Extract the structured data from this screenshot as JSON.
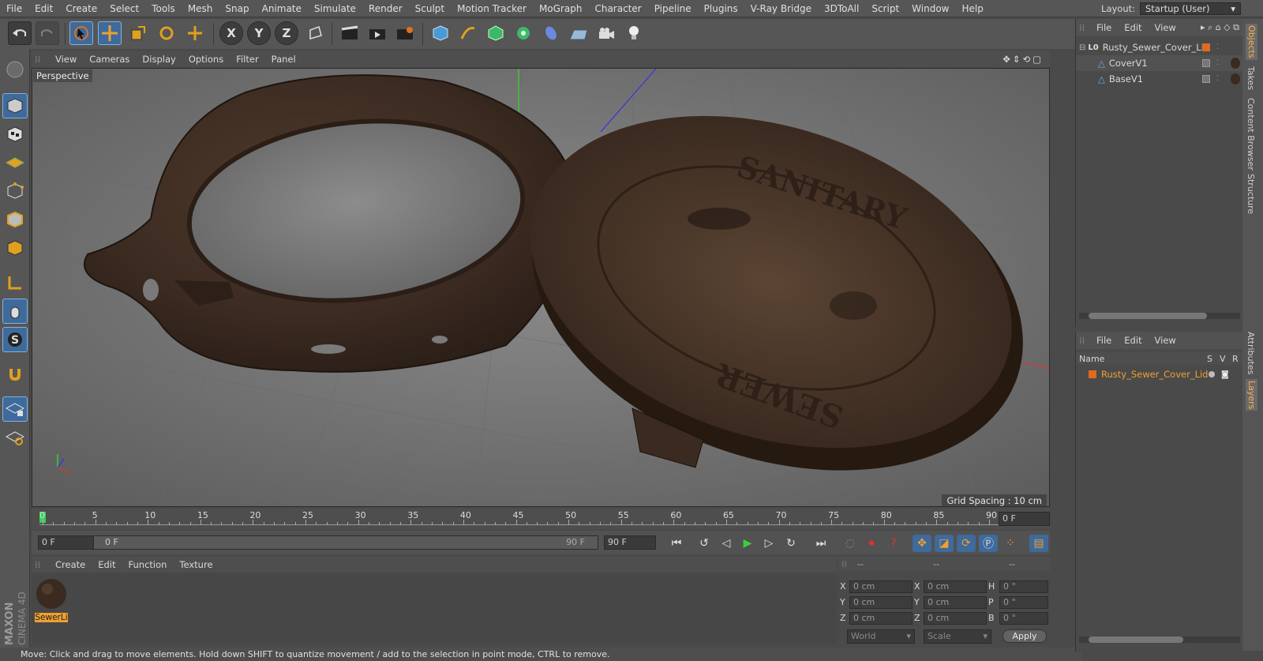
{
  "menu": [
    "File",
    "Edit",
    "Create",
    "Select",
    "Tools",
    "Mesh",
    "Snap",
    "Animate",
    "Simulate",
    "Render",
    "Sculpt",
    "Motion Tracker",
    "MoGraph",
    "Character",
    "Pipeline",
    "Plugins",
    "V-Ray Bridge",
    "3DToAll",
    "Script",
    "Window",
    "Help"
  ],
  "layout": {
    "label": "Layout:",
    "value": "Startup (User)"
  },
  "toolbar_axes": [
    "X",
    "Y",
    "Z"
  ],
  "viewport": {
    "menu": [
      "View",
      "Cameras",
      "Display",
      "Options",
      "Filter",
      "Panel"
    ],
    "camera": "Perspective",
    "grid_spacing": "Grid Spacing : 10 cm",
    "embossed_top": "SANITARY",
    "embossed_bottom": "SEWER"
  },
  "timeline": {
    "ticks": [
      "0",
      "5",
      "10",
      "15",
      "20",
      "25",
      "30",
      "35",
      "40",
      "45",
      "50",
      "55",
      "60",
      "65",
      "70",
      "75",
      "80",
      "85",
      "90"
    ],
    "current": "0 F",
    "start": "0 F",
    "range_left": "0 F",
    "range_right": "90 F",
    "end": "90 F",
    "end2": "90 F"
  },
  "material": {
    "menu": [
      "Create",
      "Edit",
      "Function",
      "Texture"
    ],
    "name": "SewerLi"
  },
  "coords": {
    "header": [
      "--",
      "--",
      "--"
    ],
    "rows": [
      {
        "a": "X",
        "v1": "0 cm",
        "b": "X",
        "v2": "0 cm",
        "c": "H",
        "v3": "0 °"
      },
      {
        "a": "Y",
        "v1": "0 cm",
        "b": "Y",
        "v2": "0 cm",
        "c": "P",
        "v3": "0 °"
      },
      {
        "a": "Z",
        "v1": "0 cm",
        "b": "Z",
        "v2": "0 cm",
        "c": "B",
        "v3": "0 °"
      }
    ],
    "mode1": "World",
    "mode2": "Scale",
    "apply": "Apply"
  },
  "status": "Move: Click and drag to move elements. Hold down SHIFT to quantize movement / add to the selection in point mode, CTRL to remove.",
  "objects": {
    "menu": [
      "File",
      "Edit",
      "View"
    ],
    "root": "Rusty_Sewer_Cover_Lid",
    "children": [
      "CoverV1",
      "BaseV1"
    ]
  },
  "layers": {
    "menu": [
      "File",
      "Edit",
      "View"
    ],
    "cols": [
      "Name",
      "S",
      "V",
      "R"
    ],
    "item": "Rusty_Sewer_Cover_Lid"
  },
  "sidetabs": [
    "Objects",
    "Takes",
    "Content Browser",
    "Structure",
    "Attributes",
    "Layers"
  ],
  "brand": {
    "line1": "MAXON",
    "line2": "CINEMA 4D"
  },
  "colors": {
    "accent": "#3e6a9c",
    "layer": "#e06a20"
  }
}
